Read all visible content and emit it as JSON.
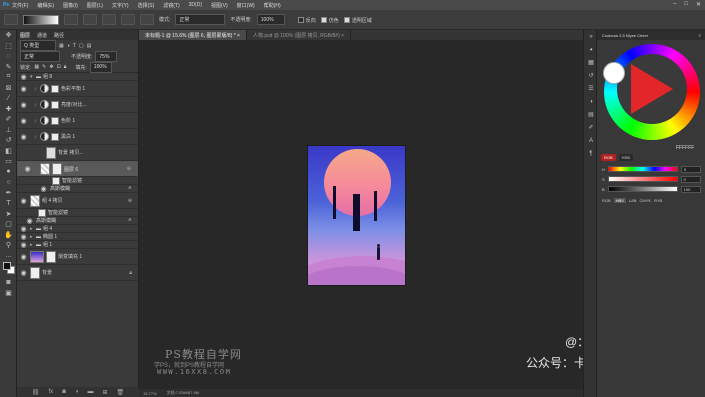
{
  "menubar": {
    "logo": "Ps",
    "items": [
      "文件(F)",
      "编辑(E)",
      "图像(I)",
      "图层(L)",
      "文字(Y)",
      "选择(S)",
      "滤镜(T)",
      "3D(D)",
      "视图(V)",
      "窗口(W)",
      "帮助(H)"
    ],
    "window_buttons": [
      "–",
      "□",
      "✕"
    ]
  },
  "options": {
    "mode_label": "模式:",
    "mode_value": "正常",
    "opacity_label": "不透明度:",
    "opacity_value": "100%",
    "reverse_label": "反向",
    "dither_label": "仿色",
    "transparency_label": "透明区域"
  },
  "layers_panel": {
    "tabs": [
      "图层",
      "通道",
      "路径"
    ],
    "filter_label": "Q 类型",
    "blend_mode": "正常",
    "opacity_label": "不透明度:",
    "opacity_value": "75%",
    "lock_label": "锁定:",
    "fill_label": "填充:",
    "fill_value": "100%",
    "layers": [
      {
        "name": "组 8",
        "kind": "group"
      },
      {
        "name": "色彩平衡 1",
        "kind": "adjust"
      },
      {
        "name": "亮度/对比...",
        "kind": "adjust"
      },
      {
        "name": "色阶 1",
        "kind": "adjust"
      },
      {
        "name": "黑白 1",
        "kind": "adjust"
      },
      {
        "name": "背景 拷贝...",
        "kind": "image"
      },
      {
        "name": "图层 6",
        "kind": "image"
      },
      {
        "name": "智能滤镜",
        "kind": "sub"
      },
      {
        "name": "高斯模糊",
        "kind": "sub"
      },
      {
        "name": "组 4 拷贝",
        "kind": "image"
      },
      {
        "name": "智能滤镜",
        "kind": "sub"
      },
      {
        "name": "高斯模糊",
        "kind": "sub"
      },
      {
        "name": "组 4",
        "kind": "group"
      },
      {
        "name": "椭圆 1",
        "kind": "image"
      },
      {
        "name": "组 1",
        "kind": "group"
      },
      {
        "name": "渐变填充 1",
        "kind": "image"
      },
      {
        "name": "背景",
        "kind": "image"
      }
    ],
    "bottom_icons": [
      "link-icon",
      "fx-icon",
      "mask-icon",
      "adjust-icon",
      "folder-icon",
      "new-layer-icon",
      "trash-icon"
    ]
  },
  "document_tabs": [
    {
      "label": "未标题-1 @ 15.6% (图层 6, 图层蒙版/8) * ×",
      "active": true
    },
    {
      "label": "人物.psd @ 100% (图层 拷贝, RGB/8#) ×",
      "active": false
    }
  ],
  "status": {
    "zoom": "15.77%",
    "doc_info": "文档:7.03M/67.9M"
  },
  "color_panel": {
    "title": "Coolorus 2.5 Niyee Cheer",
    "hex_value": "FFFFFF",
    "mode_tabs": [
      "RGB",
      "HSB"
    ],
    "sliders": [
      {
        "label": "H",
        "value": "0",
        "gradient": "hue"
      },
      {
        "label": "S",
        "value": "0",
        "gradient": "sat"
      },
      {
        "label": "B",
        "value": "100",
        "gradient": "bri"
      }
    ],
    "space_tabs": [
      "RGB",
      "HBV",
      "LAB",
      "CMYK",
      "RYB"
    ]
  },
  "watermarks": {
    "title": "PS教程自学网",
    "subtitle": "学PS，就到PS教程自学网",
    "url": "WWW.16XX8.COM",
    "author_line": "@：卡乐筠",
    "wechat_line": "公众号：卡乐筠"
  },
  "colors": {
    "accent": "#31a8ff",
    "panel_bg": "#3a3a3a",
    "selected_layer": "#595959",
    "canvas_bg": "#282828"
  }
}
